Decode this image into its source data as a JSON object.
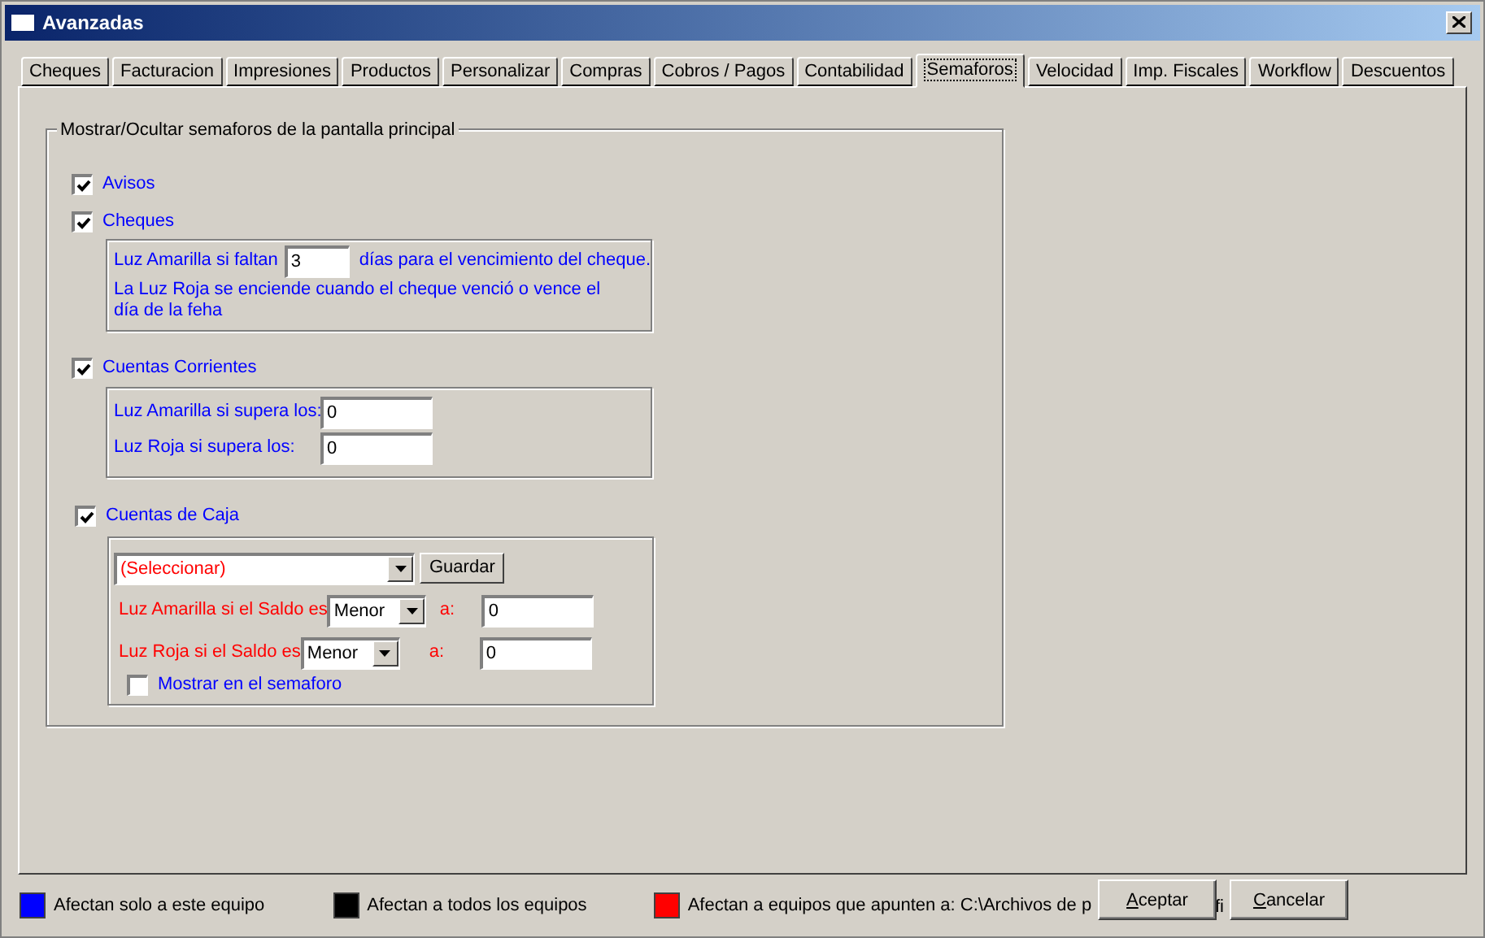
{
  "window": {
    "title": "Avanzadas"
  },
  "tabs": [
    {
      "label": "Cheques",
      "selected": false
    },
    {
      "label": "Facturacion",
      "selected": false
    },
    {
      "label": "Impresiones",
      "selected": false
    },
    {
      "label": "Productos",
      "selected": false
    },
    {
      "label": "Personalizar",
      "selected": false
    },
    {
      "label": "Compras",
      "selected": false
    },
    {
      "label": "Cobros / Pagos",
      "selected": false
    },
    {
      "label": "Contabilidad",
      "selected": false
    },
    {
      "label": "Semaforos",
      "selected": true
    },
    {
      "label": "Velocidad",
      "selected": false
    },
    {
      "label": "Imp. Fiscales",
      "selected": false
    },
    {
      "label": "Workflow",
      "selected": false
    },
    {
      "label": "Descuentos",
      "selected": false
    }
  ],
  "group": {
    "title": "Mostrar/Ocultar semaforos de la pantalla principal",
    "avisos": {
      "label": "Avisos",
      "checked": true,
      "color": "#0000ff"
    },
    "cheques": {
      "label": "Cheques",
      "checked": true,
      "color": "#0000ff",
      "amarilla": {
        "text": "Luz Amarilla si faltan",
        "color": "#0000ff"
      },
      "amarilla_value": "3",
      "amarilla_suffix": {
        "text": "días para el vencimiento del cheque.",
        "color": "#0000ff"
      },
      "note_lines": [
        {
          "text": "La Luz Roja se enciende cuando el cheque venció o vence el",
          "color": "#0000ff"
        },
        {
          "text": "día de la feha",
          "color": "#0000ff"
        }
      ]
    },
    "cuentas_corrientes": {
      "label": "Cuentas Corrientes",
      "checked": true,
      "color": "#0000ff",
      "rows": [
        {
          "text": "Luz Amarilla si supera los:",
          "color": "#0000ff",
          "value": "0"
        },
        {
          "text": "Luz Roja si supera los:",
          "color": "#0000ff",
          "value": "0"
        }
      ]
    },
    "cuentas_caja": {
      "label": "Cuentas de Caja",
      "checked": true,
      "color": "#0000ff",
      "select": {
        "value": "(Seleccionar)",
        "color": "#ff0000"
      },
      "save_button": "Guardar",
      "rows": [
        {
          "text": "Luz Amarilla si el Saldo es",
          "color": "#ff0000",
          "operator": "Menor",
          "a_label": "a:",
          "value": "0"
        },
        {
          "text": "Luz Roja si el Saldo es",
          "color": "#ff0000",
          "operator": "Menor",
          "a_label": "a:",
          "value": "0"
        }
      ],
      "show": {
        "label": "Mostrar en el semaforo",
        "checked": false,
        "color": "#0000ff"
      }
    }
  },
  "legend": [
    {
      "color": "#0000ff",
      "text": "Afectan solo a este equipo"
    },
    {
      "color": "#000000",
      "text": "Afectan a todos los equipos"
    },
    {
      "color": "#ff0000",
      "text": "Afectan a equipos que apunten a: C:\\Archivos de p",
      "tail": "fi"
    }
  ],
  "buttons": [
    {
      "label": "Aceptar"
    },
    {
      "label": "Cancelar"
    }
  ]
}
